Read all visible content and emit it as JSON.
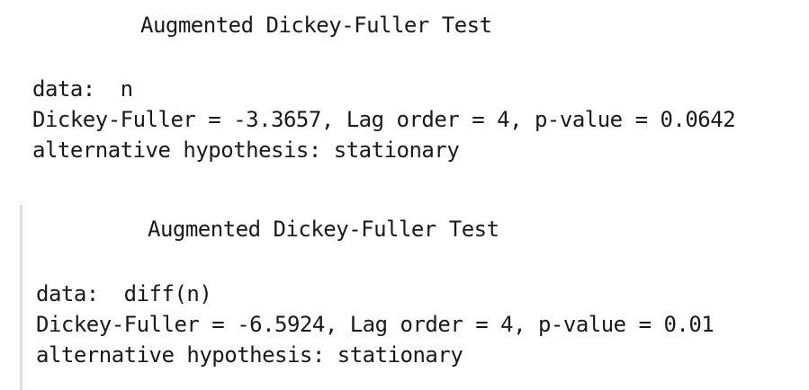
{
  "test_1": {
    "title": "Augmented Dickey-Fuller Test",
    "data_line": "data:  n",
    "stat_line": "Dickey-Fuller = -3.3657, Lag order = 4, p-value = 0.0642",
    "alternative_line": "alternative hypothesis: stationary"
  },
  "test_2": {
    "title": "Augmented Dickey-Fuller Test",
    "data_line": "data:  diff(n)",
    "stat_line": "Dickey-Fuller = -6.5924, Lag order = 4, p-value = 0.01",
    "alternative_line": "alternative hypothesis: stationary"
  },
  "colors": {
    "text": "#1a1a1a",
    "quote_bar": "#dcdcdc",
    "background": "#ffffff"
  }
}
